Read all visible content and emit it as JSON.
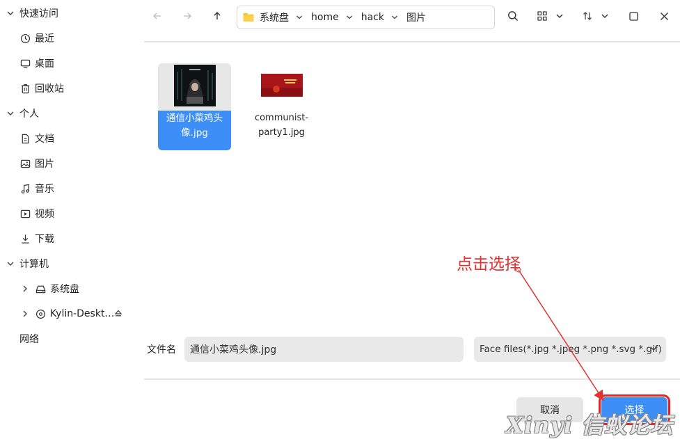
{
  "sidebar": {
    "sections": [
      {
        "label": "快速访问"
      },
      {
        "label": "个人"
      },
      {
        "label": "计算机"
      },
      {
        "label": "网络"
      }
    ],
    "quick": [
      {
        "label": "最近",
        "icon": "clock-icon"
      },
      {
        "label": "桌面",
        "icon": "monitor-icon"
      },
      {
        "label": "回收站",
        "icon": "trash-icon"
      }
    ],
    "personal": [
      {
        "label": "文档",
        "icon": "document-icon"
      },
      {
        "label": "图片",
        "icon": "image-icon"
      },
      {
        "label": "音乐",
        "icon": "music-icon"
      },
      {
        "label": "视频",
        "icon": "video-icon"
      },
      {
        "label": "下载",
        "icon": "download-icon"
      }
    ],
    "computer": [
      {
        "label": "系统盘",
        "icon": "drive-icon"
      },
      {
        "label": "Kylin-Deskt…",
        "icon": "disc-icon"
      }
    ]
  },
  "toolbar": {
    "path": [
      "系统盘",
      "home",
      "hack",
      "图片"
    ]
  },
  "files": [
    {
      "name": "通信小菜鸡头像.jpg",
      "selected": true
    },
    {
      "name": "communist-party1.jpg",
      "selected": false
    }
  ],
  "filename": {
    "label": "文件名",
    "value": "通信小菜鸡头像.jpg"
  },
  "filter": {
    "selected": "Face files(*.jpg *.jpeg *.png *.svg *.gif)"
  },
  "buttons": {
    "cancel": "取消",
    "choose": "选择"
  },
  "annotation": {
    "text": "点击选择",
    "color": "#e53030"
  },
  "watermark": "Xinyi 信蚁论坛",
  "colors": {
    "accent": "#3d8ff7",
    "highlight": "#e82222"
  }
}
